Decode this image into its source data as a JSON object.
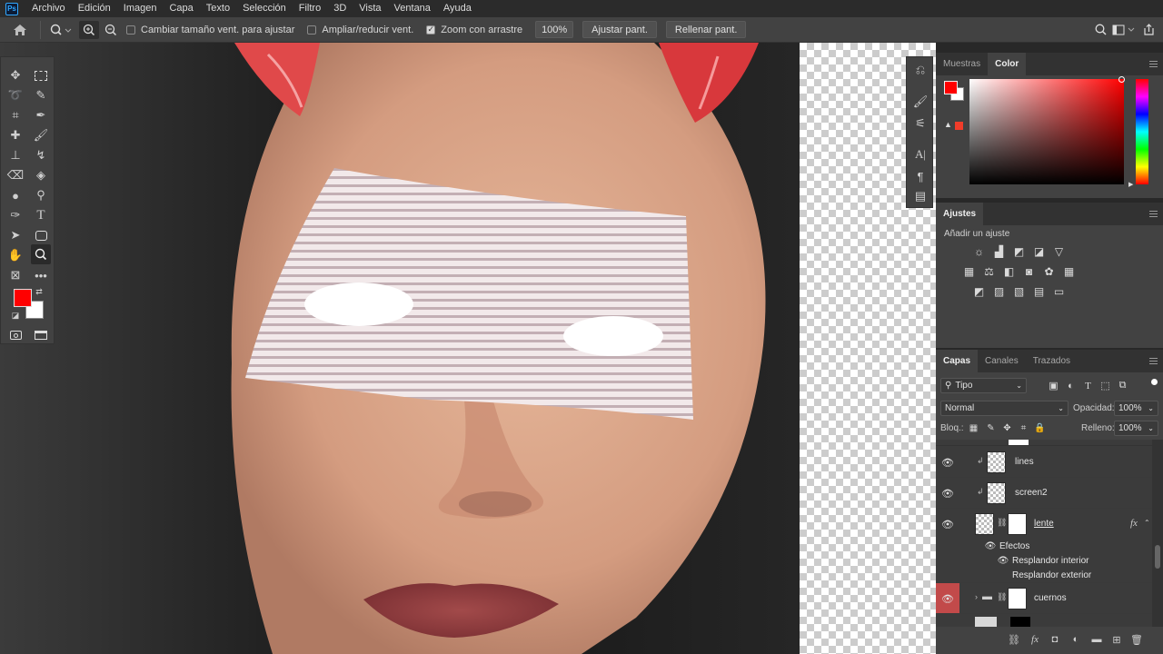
{
  "menu": [
    "Archivo",
    "Edición",
    "Imagen",
    "Capa",
    "Texto",
    "Selección",
    "Filtro",
    "3D",
    "Vista",
    "Ventana",
    "Ayuda"
  ],
  "app_logo": "Ps",
  "options": {
    "resize_windows": "Cambiar tamaño vent. para ajustar",
    "zoom_all": "Ampliar/reducir vent.",
    "scrubby_zoom": "Zoom con arrastre",
    "zoom_value": "100%",
    "fit_screen": "Ajustar pant.",
    "fill_screen": "Rellenar pant."
  },
  "color_panel": {
    "tabs": [
      "Muestras",
      "Color"
    ],
    "active_tab": "Color",
    "foreground": "#ff0000",
    "background": "#ffffff"
  },
  "adjustments": {
    "title": "Ajustes",
    "subtitle": "Añadir un ajuste"
  },
  "layers_panel": {
    "tabs": [
      "Capas",
      "Canales",
      "Trazados"
    ],
    "filter_label": "Tipo",
    "blend_mode": "Normal",
    "opacity_label": "Opacidad:",
    "opacity": "100%",
    "lock_label": "Bloq.:",
    "fill_label": "Relleno:",
    "fill": "100%",
    "layers": [
      {
        "name": "lines"
      },
      {
        "name": "screen2"
      },
      {
        "name": "lente",
        "fx": "fx"
      },
      {
        "name": "cuernos"
      }
    ],
    "effects_label": "Efectos",
    "effects": [
      "Resplandor interior",
      "Resplandor exterior"
    ]
  }
}
